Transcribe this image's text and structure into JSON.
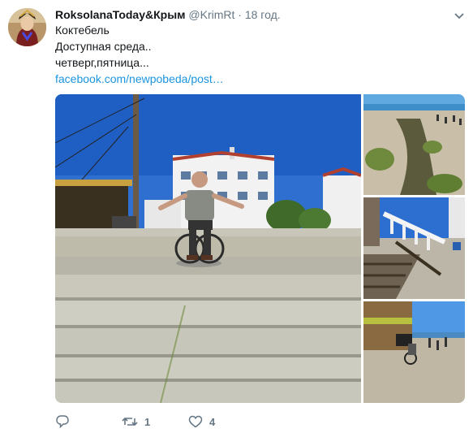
{
  "tweet": {
    "author_name": "RoksolanaToday&Крым",
    "author_handle": "@KrimRt",
    "separator": "·",
    "time": "18 год.",
    "lines": [
      "Коктебель",
      "Доступная среда..",
      "четверг,пятница..."
    ],
    "link": "facebook.com/newpobeda/post…"
  },
  "actions": {
    "reply_count": "",
    "retweet_count": "1",
    "like_count": "4"
  },
  "icons": {
    "more": "chevron-down-icon",
    "reply": "reply-icon",
    "retweet": "retweet-icon",
    "like": "heart-icon"
  },
  "colors": {
    "link": "#1b95e0",
    "muted": "#657786",
    "text": "#14171a"
  }
}
